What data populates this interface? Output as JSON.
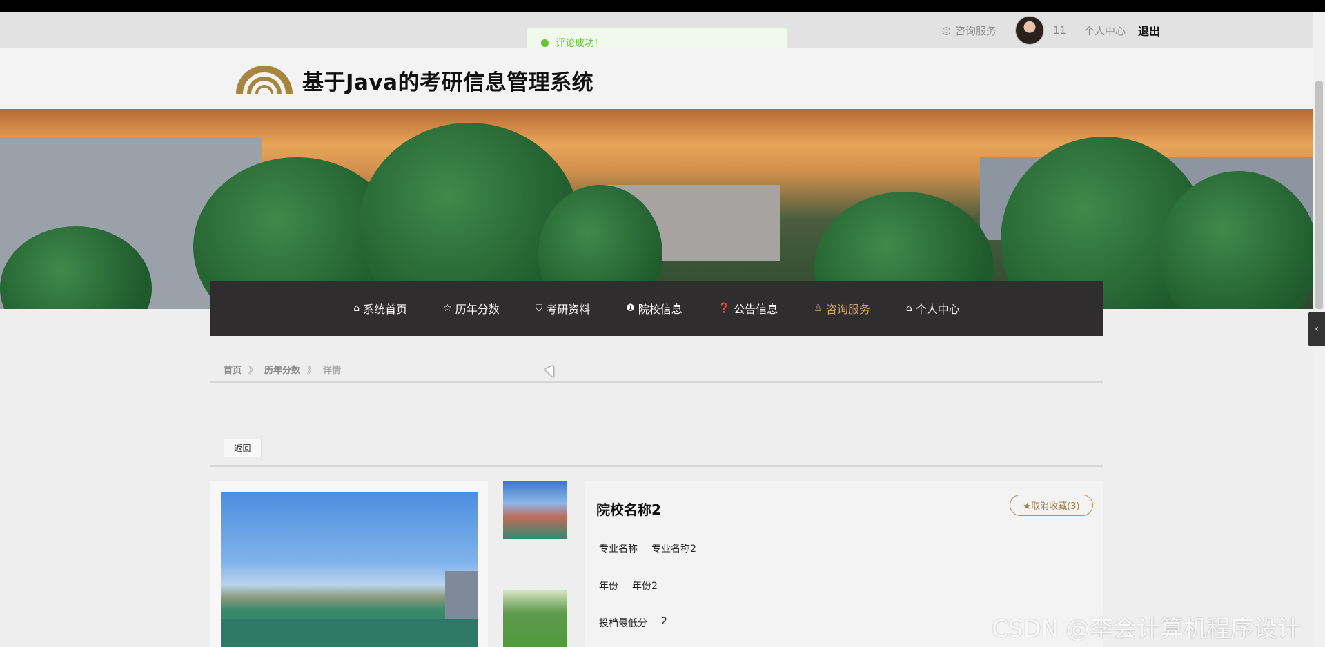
{
  "topbar": {
    "consult_label": "咨询服务",
    "username": "11",
    "personal_center": "个人中心",
    "logout": "退出"
  },
  "toast": {
    "message": "评论成功!",
    "color": "#67c23a"
  },
  "header": {
    "site_title": "基于Java的考研信息管理系统",
    "logo_icon": "arch-logo-icon",
    "accent": "#a8853f"
  },
  "nav": {
    "items": [
      {
        "label": "系统首页",
        "icon": "home-icon"
      },
      {
        "label": "历年分数",
        "icon": "star-icon"
      },
      {
        "label": "考研资料",
        "icon": "bag-icon"
      },
      {
        "label": "院校信息",
        "icon": "info-icon"
      },
      {
        "label": "公告信息",
        "icon": "question-icon"
      },
      {
        "label": "咨询服务",
        "icon": "person-icon",
        "active": true
      },
      {
        "label": "个人中心",
        "icon": "home-icon"
      }
    ],
    "active_color": "#d3a46a"
  },
  "breadcrumb": {
    "home": "首页",
    "section": "历年分数",
    "current": "详情",
    "separator": "》"
  },
  "back_label": "返回",
  "detail": {
    "school_name": "院校名称2",
    "favorite_label": "★取消收藏(3)",
    "fields": [
      {
        "label": "专业名称",
        "value": "专业名称2"
      },
      {
        "label": "年份",
        "value": "年份2"
      },
      {
        "label": "投档最低分",
        "value": "2"
      }
    ]
  },
  "watermark": "CSDN @李会计算机程序设计"
}
